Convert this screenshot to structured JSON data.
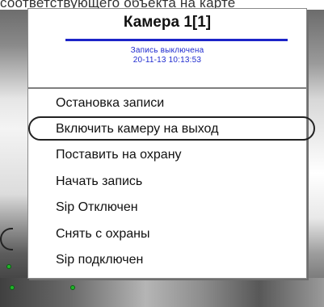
{
  "background": {
    "top_text": "соответствующего объекта на карте"
  },
  "menu": {
    "camera_title": "Камера 1[1]",
    "status": "Запись выключена",
    "timestamp": "20-11-13 10:13:53",
    "items": [
      {
        "label": "Остановка записи"
      },
      {
        "label": "Включить камеру на выход"
      },
      {
        "label": "Поставить на охрану"
      },
      {
        "label": "Начать запись"
      },
      {
        "label": "Sip Отключен"
      },
      {
        "label": "Снять с охраны"
      },
      {
        "label": "Sip подключен"
      }
    ],
    "highlighted_item": "Включить камеру на выход"
  },
  "colors": {
    "accent_blue": "#1c24c8",
    "status_text_blue": "#1f2bcf",
    "indicator_green": "#22b42a"
  }
}
